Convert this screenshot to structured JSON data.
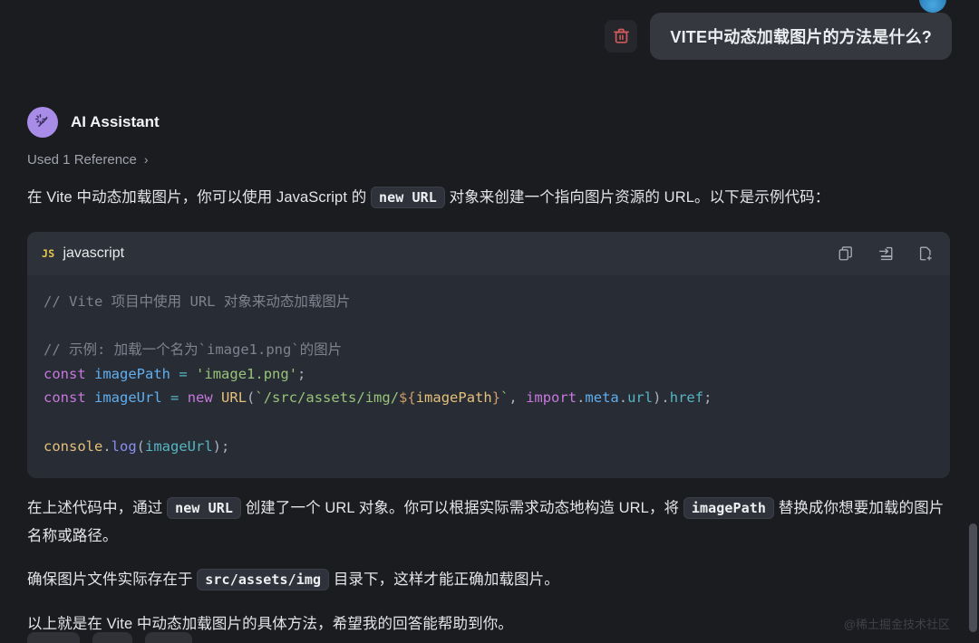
{
  "window": {
    "background": "#1b1c20",
    "accent": "#a98ce8"
  },
  "user_message": {
    "text": "VITE中动态加载图片的方法是什么?",
    "delete_icon": "trash-icon",
    "delete_color": "#d05a5a"
  },
  "assistant": {
    "avatar_icon": "magic-wand-sparkle-icon",
    "name": "AI Assistant",
    "reference": {
      "label": "Used 1 Reference",
      "chevron": "›"
    }
  },
  "paragraph1": {
    "part1": "在 Vite 中动态加载图片，你可以使用 JavaScript 的 ",
    "code1": "new URL",
    "part2": " 对象来创建一个指向图片资源的 URL。以下是示例代码："
  },
  "codeblock": {
    "lang_badge": "JS",
    "lang_name": "javascript",
    "actions": [
      {
        "name": "copy-code-icon",
        "title": "Copy"
      },
      {
        "name": "insert-into-editor-icon",
        "title": "Insert"
      },
      {
        "name": "new-file-icon",
        "title": "New file"
      }
    ],
    "lines": [
      {
        "tokens": [
          {
            "t": "// Vite 项目中使用 URL 对象来动态加载图片",
            "c": "c-comment"
          }
        ]
      },
      {
        "tokens": []
      },
      {
        "tokens": [
          {
            "t": "// 示例: 加载一个名为`image1.png`的图片",
            "c": "c-comment"
          }
        ]
      },
      {
        "tokens": [
          {
            "t": "const",
            "c": "c-kw"
          },
          {
            "t": " ",
            "c": "c-punct"
          },
          {
            "t": "imagePath",
            "c": "c-var"
          },
          {
            "t": " ",
            "c": "c-punct"
          },
          {
            "t": "=",
            "c": "c-op"
          },
          {
            "t": " ",
            "c": "c-punct"
          },
          {
            "t": "'image1.png'",
            "c": "c-str"
          },
          {
            "t": ";",
            "c": "c-punct"
          }
        ]
      },
      {
        "tokens": [
          {
            "t": "const",
            "c": "c-kw"
          },
          {
            "t": " ",
            "c": "c-punct"
          },
          {
            "t": "imageUrl",
            "c": "c-var"
          },
          {
            "t": " ",
            "c": "c-punct"
          },
          {
            "t": "=",
            "c": "c-op"
          },
          {
            "t": " ",
            "c": "c-punct"
          },
          {
            "t": "new",
            "c": "c-kw"
          },
          {
            "t": " ",
            "c": "c-punct"
          },
          {
            "t": "URL",
            "c": "c-fn"
          },
          {
            "t": "(",
            "c": "c-punct"
          },
          {
            "t": "`/src/assets/img/",
            "c": "c-str"
          },
          {
            "t": "${",
            "c": "c-tmpl"
          },
          {
            "t": "imagePath",
            "c": "c-tvar"
          },
          {
            "t": "}",
            "c": "c-tmpl"
          },
          {
            "t": "`",
            "c": "c-str"
          },
          {
            "t": ", ",
            "c": "c-punct"
          },
          {
            "t": "import",
            "c": "c-kw"
          },
          {
            "t": ".",
            "c": "c-punct"
          },
          {
            "t": "meta",
            "c": "c-var"
          },
          {
            "t": ".",
            "c": "c-punct"
          },
          {
            "t": "url",
            "c": "c-prop"
          },
          {
            "t": ")",
            "c": "c-punct"
          },
          {
            "t": ".",
            "c": "c-punct"
          },
          {
            "t": "href",
            "c": "c-prop"
          },
          {
            "t": ";",
            "c": "c-punct"
          }
        ]
      },
      {
        "tokens": []
      },
      {
        "tokens": [
          {
            "t": "console",
            "c": "c-fn"
          },
          {
            "t": ".",
            "c": "c-punct"
          },
          {
            "t": "log",
            "c": "c-method"
          },
          {
            "t": "(",
            "c": "c-punct"
          },
          {
            "t": "imageUrl",
            "c": "c-prop"
          },
          {
            "t": ")",
            "c": "c-punct"
          },
          {
            "t": ";",
            "c": "c-punct"
          }
        ]
      }
    ]
  },
  "paragraph2": {
    "part1": "在上述代码中，通过 ",
    "code1": "new URL",
    "part2": " 创建了一个 URL 对象。你可以根据实际需求动态地构造 URL，将 ",
    "code2": "imagePath",
    "part3": " 替换成你想要加载的图片名称或路径。"
  },
  "paragraph3": {
    "part1": "确保图片文件实际存在于 ",
    "code1": "src/assets/img",
    "part2": " 目录下，这样才能正确加载图片。"
  },
  "paragraph4": {
    "text": "以上就是在 Vite 中动态加载图片的具体方法，希望我的回答能帮助到你。"
  },
  "watermark": {
    "text": "@稀土掘金技术社区"
  }
}
